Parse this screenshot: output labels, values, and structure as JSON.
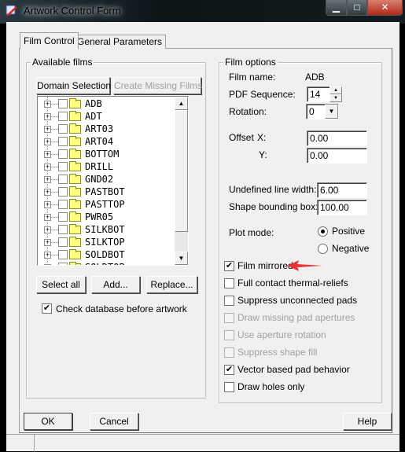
{
  "window": {
    "title": "Artwork Control Form",
    "minimize": "▁",
    "maximize": "□",
    "close": "✕"
  },
  "tabs": [
    {
      "label": "Film Control",
      "active": true
    },
    {
      "label": "General Parameters",
      "active": false
    }
  ],
  "available_films": {
    "title": "Available films",
    "domain_selection": "Domain Selection",
    "create_missing": "Create Missing Films",
    "films": [
      "ADB",
      "ADT",
      "ART03",
      "ART04",
      "BOTTOM",
      "DRILL",
      "GND02",
      "PASTBOT",
      "PASTTOP",
      "PWR05",
      "SILKBOT",
      "SILKTOP",
      "SOLDBOT",
      "SOLDTOP"
    ],
    "select_all": "Select all",
    "add": "Add...",
    "replace": "Replace...",
    "check_db_label": "Check database before artwork",
    "check_db_checked": true
  },
  "film_options": {
    "title": "Film options",
    "film_name_label": "Film name:",
    "film_name_value": "ADB",
    "pdf_sequence_label": "PDF Sequence:",
    "pdf_sequence_value": "14",
    "rotation_label": "Rotation:",
    "rotation_value": "0",
    "offset_label": "Offset",
    "offset_x_label": "X:",
    "offset_x_value": "0.00",
    "offset_y_label": "Y:",
    "offset_y_value": "0.00",
    "undef_line_width_label": "Undefined line width:",
    "undef_line_width_value": "6.00",
    "shape_bbox_label": "Shape bounding box:",
    "shape_bbox_value": "100.00",
    "plot_mode_label": "Plot mode:",
    "plot_mode_options": [
      "Positive",
      "Negative"
    ],
    "plot_mode_selected": "Positive",
    "checkboxes": [
      {
        "label": "Film mirrored",
        "checked": true,
        "enabled": true
      },
      {
        "label": "Full contact thermal-reliefs",
        "checked": false,
        "enabled": true
      },
      {
        "label": "Suppress unconnected pads",
        "checked": false,
        "enabled": true
      },
      {
        "label": "Draw missing pad apertures",
        "checked": false,
        "enabled": false
      },
      {
        "label": "Use aperture rotation",
        "checked": false,
        "enabled": false
      },
      {
        "label": "Suppress shape fill",
        "checked": false,
        "enabled": false
      },
      {
        "label": "Vector based pad behavior",
        "checked": true,
        "enabled": true
      },
      {
        "label": "Draw holes only",
        "checked": false,
        "enabled": true
      }
    ]
  },
  "annotation": {
    "arrow_color": "#f03030"
  },
  "footer": {
    "ok": "OK",
    "cancel": "Cancel",
    "help": "Help"
  }
}
